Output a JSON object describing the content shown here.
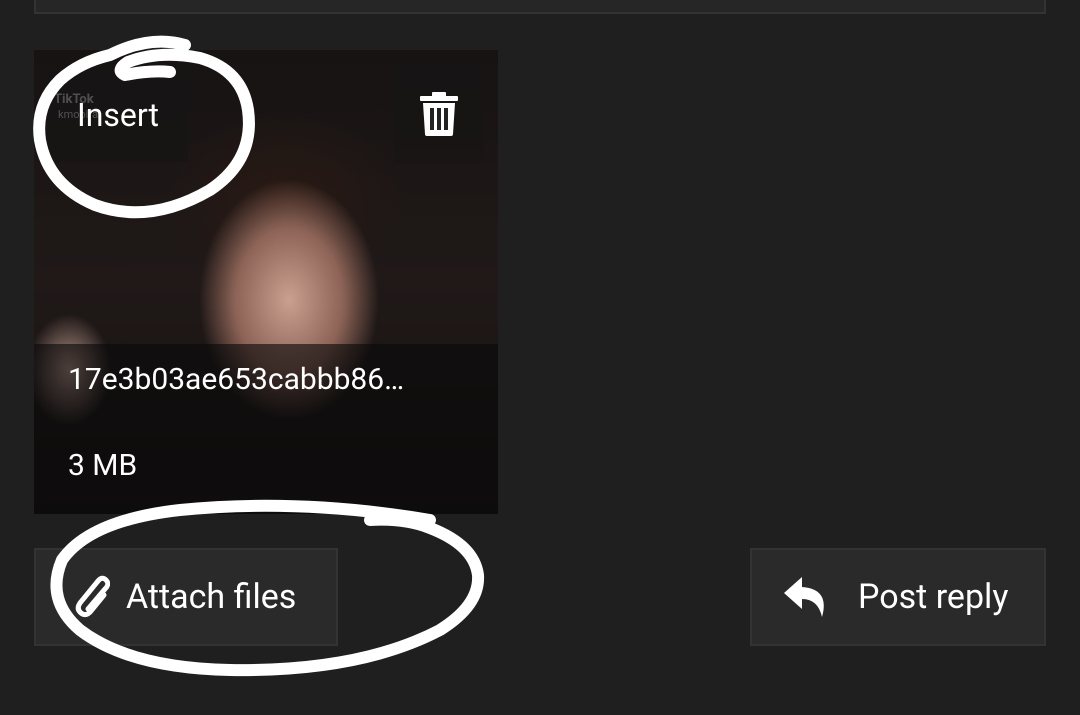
{
  "attachment": {
    "insert_label": "Insert",
    "filename": "17e3b03ae653cabbb86…",
    "filesize": "3 MB",
    "delete_icon": "trash-icon",
    "watermark_brand": "TikTok",
    "watermark_user": "kmoblfa"
  },
  "actions": {
    "attach_label": "Attach files",
    "attach_icon": "paperclip-icon",
    "post_label": "Post reply",
    "post_icon": "reply-icon"
  },
  "colors": {
    "background": "#1f1f1f",
    "button_bg": "#2a2a2a",
    "text": "#ffffff"
  }
}
